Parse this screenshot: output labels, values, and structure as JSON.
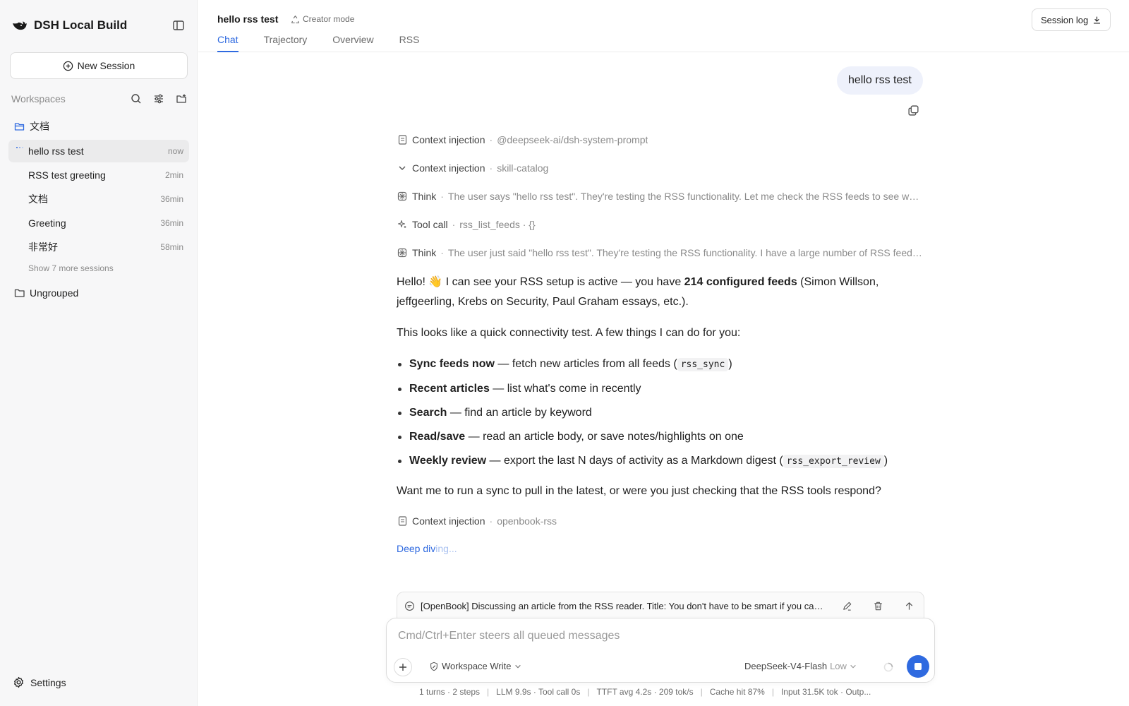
{
  "app": {
    "title": "DSH Local Build"
  },
  "sidebar": {
    "new_session_label": "New Session",
    "workspaces_label": "Workspaces",
    "groups": [
      {
        "name": "文档",
        "open": true
      },
      {
        "name": "Ungrouped",
        "open": false
      }
    ],
    "sessions": [
      {
        "title": "hello rss test",
        "time": "now",
        "active": true
      },
      {
        "title": "RSS test greeting",
        "time": "2min"
      },
      {
        "title": "文档",
        "time": "36min"
      },
      {
        "title": "Greeting",
        "time": "36min"
      },
      {
        "title": "非常好",
        "time": "58min"
      }
    ],
    "show_more_label": "Show 7 more sessions",
    "settings_label": "Settings"
  },
  "header": {
    "title": "hello rss test",
    "mode_label": "Creator mode",
    "tabs": [
      "Chat",
      "Trajectory",
      "Overview",
      "RSS"
    ],
    "active_tab": "Chat",
    "session_log_label": "Session log"
  },
  "chat": {
    "user_message": "hello rss test",
    "steps": [
      {
        "icon": "document-icon",
        "kind": "Context injection",
        "detail": "@deepseek-ai/dsh-system-prompt"
      },
      {
        "icon": "chevron-down-icon",
        "kind": "Context injection",
        "detail": "skill-catalog"
      },
      {
        "icon": "brain-icon",
        "kind": "Think",
        "detail": "The user says \"hello rss test\". They're testing the RSS functionality. Let me check the RSS feeds to see what's available."
      },
      {
        "icon": "sparkle-icon",
        "kind": "Tool call",
        "detail": "rss_list_feeds · {}"
      },
      {
        "icon": "brain-icon",
        "kind": "Think",
        "detail": "The user just said \"hello rss test\". They're testing the RSS functionality. I have a large number of RSS feeds configured."
      }
    ],
    "answer": {
      "intro_a": "Hello! 👋 I can see your RSS setup is active — you have ",
      "intro_bold": "214 configured feeds",
      "intro_b": " (Simon Willson, jeffgeerling, Krebs on Security, Paul Graham essays, etc.).",
      "lead": "This looks like a quick connectivity test. A few things I can do for you:",
      "bullets": [
        {
          "bold": "Sync feeds now",
          "text": " — fetch new articles from all feeds (",
          "code": "rss_sync",
          "tail": ")"
        },
        {
          "bold": "Recent articles",
          "text": " — list what's come in recently"
        },
        {
          "bold": "Search",
          "text": " — find an article by keyword"
        },
        {
          "bold": "Read/save",
          "text": " — read an article body, or save notes/highlights on one"
        },
        {
          "bold": "Weekly review",
          "text": " — export the last N days of activity as a Markdown digest (",
          "code": "rss_export_review",
          "tail": ")"
        }
      ],
      "outro": "Want me to run a sync to pull in the latest, or were you just checking that the RSS tools respond?"
    },
    "final_step": {
      "icon": "document-icon",
      "kind": "Context injection",
      "detail": "openbook-rss"
    },
    "status": {
      "main": "Deep div",
      "fade": "ing..."
    }
  },
  "queue": {
    "text": "[OpenBook] Discussing an article from the RSS reader. Title: You don't have to be smart if you can work hard"
  },
  "composer": {
    "placeholder": "Cmd/Ctrl+Enter steers all queued messages",
    "permission_label": "Workspace Write",
    "model_label": "DeepSeek-V4-Flash",
    "effort_label": "Low"
  },
  "stats": [
    "1 turns · 2 steps",
    "LLM 9.9s · Tool call 0s",
    "TTFT avg 4.2s · 209 tok/s",
    "Cache hit 87%",
    "Input 31.5K tok · Outp..."
  ],
  "colors": {
    "accent": "#2f6ae0",
    "sidebar_bg": "#f7f7f8",
    "bubble_bg": "#eef1fb"
  }
}
